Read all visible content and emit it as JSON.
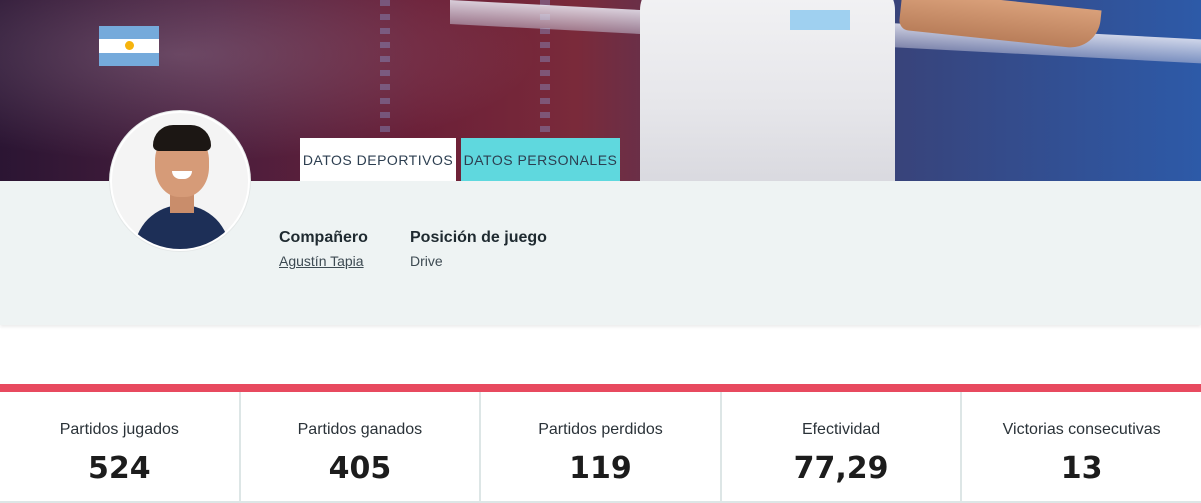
{
  "hero": {
    "flag_icon": "argentina-flag-icon",
    "flag_colors": [
      "#75aadb",
      "#ffffff",
      "#f6b40e"
    ]
  },
  "tabs": [
    {
      "label": "DATOS DEPORTIVOS",
      "active": true
    },
    {
      "label": "DATOS PERSONALES",
      "active": false
    }
  ],
  "profile": {
    "partner": {
      "label": "Compañero",
      "value": "Agustín Tapia"
    },
    "position": {
      "label": "Posición de juego",
      "value": "Drive"
    }
  },
  "stats": [
    {
      "label": "Partidos jugados",
      "value": "524"
    },
    {
      "label": "Partidos ganados",
      "value": "405"
    },
    {
      "label": "Partidos perdidos",
      "value": "119"
    },
    {
      "label": "Efectividad",
      "value": "77,29"
    },
    {
      "label": "Victorias consecutivas",
      "value": "13"
    }
  ],
  "colors": {
    "accent_red": "#e84a5f",
    "tab_active_bg": "#ffffff",
    "tab_inactive_bg": "#5fd8de",
    "panel_bg": "#eef3f3"
  }
}
